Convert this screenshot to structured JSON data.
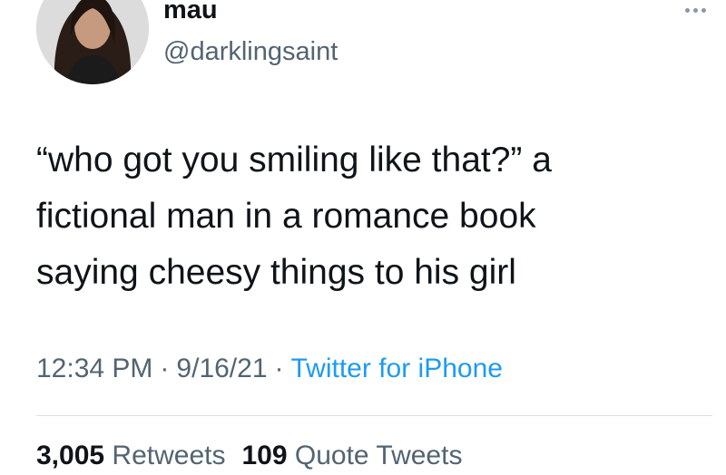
{
  "author": {
    "display_name": "mau",
    "handle": "@darklingsaint",
    "avatar_icon": "profile-photo"
  },
  "tweet": {
    "lines": [
      "“who got you smiling like that?” a",
      "fictional man in a romance book",
      "saying cheesy things to his girl"
    ]
  },
  "meta": {
    "time": "12:34 PM",
    "separator": "·",
    "date": "9/16/21",
    "source": "Twitter for iPhone"
  },
  "stats": {
    "retweets_count": "3,005",
    "retweets_label": "Retweets",
    "quotes_count": "109",
    "quotes_label": "Quote Tweets"
  },
  "colors": {
    "text": "#0f1419",
    "secondary": "#536471",
    "link": "#1d9bf0",
    "divider": "#dcdfe2"
  },
  "icons": {
    "more": "more-horizontal-icon"
  }
}
